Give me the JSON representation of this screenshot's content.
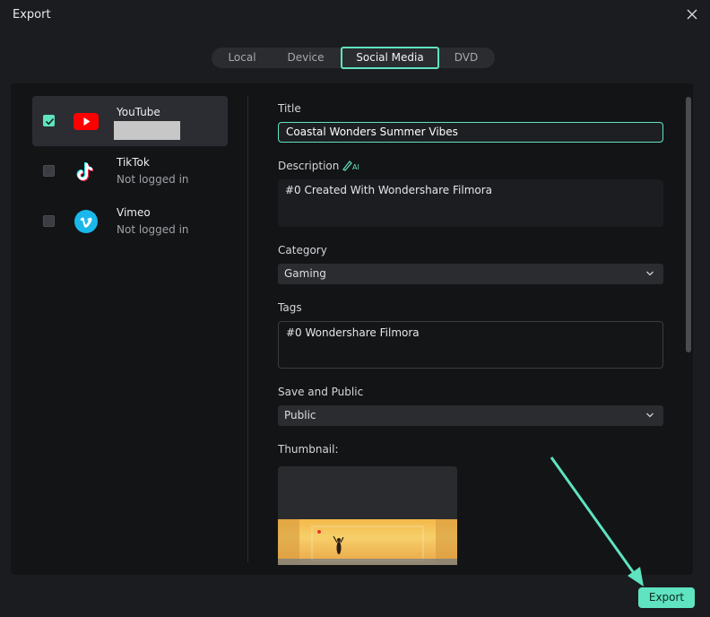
{
  "window": {
    "title": "Export"
  },
  "tabs": [
    {
      "label": "Local"
    },
    {
      "label": "Device"
    },
    {
      "label": "Social Media"
    },
    {
      "label": "DVD"
    }
  ],
  "active_tab": "Social Media",
  "platforms": [
    {
      "name": "YouTube",
      "status": "",
      "checked": true,
      "icon": "youtube-icon"
    },
    {
      "name": "TikTok",
      "status": "Not logged in",
      "checked": false,
      "icon": "tiktok-icon"
    },
    {
      "name": "Vimeo",
      "status": "Not logged in",
      "checked": false,
      "icon": "vimeo-icon"
    }
  ],
  "form": {
    "title_label": "Title",
    "title_value": "Coastal Wonders Summer Vibes",
    "description_label": "Description",
    "description_value": "#0 Created With Wondershare Filmora",
    "category_label": "Category",
    "category_value": "Gaming",
    "tags_label": "Tags",
    "tags_value": "#0 Wondershare Filmora",
    "privacy_label": "Save and Public",
    "privacy_value": "Public",
    "thumbnail_label": "Thumbnail:"
  },
  "footer": {
    "export_label": "Export"
  },
  "colors": {
    "accent": "#5fe3c0",
    "youtube": "#ff0000",
    "vimeo": "#1ab7ea"
  }
}
